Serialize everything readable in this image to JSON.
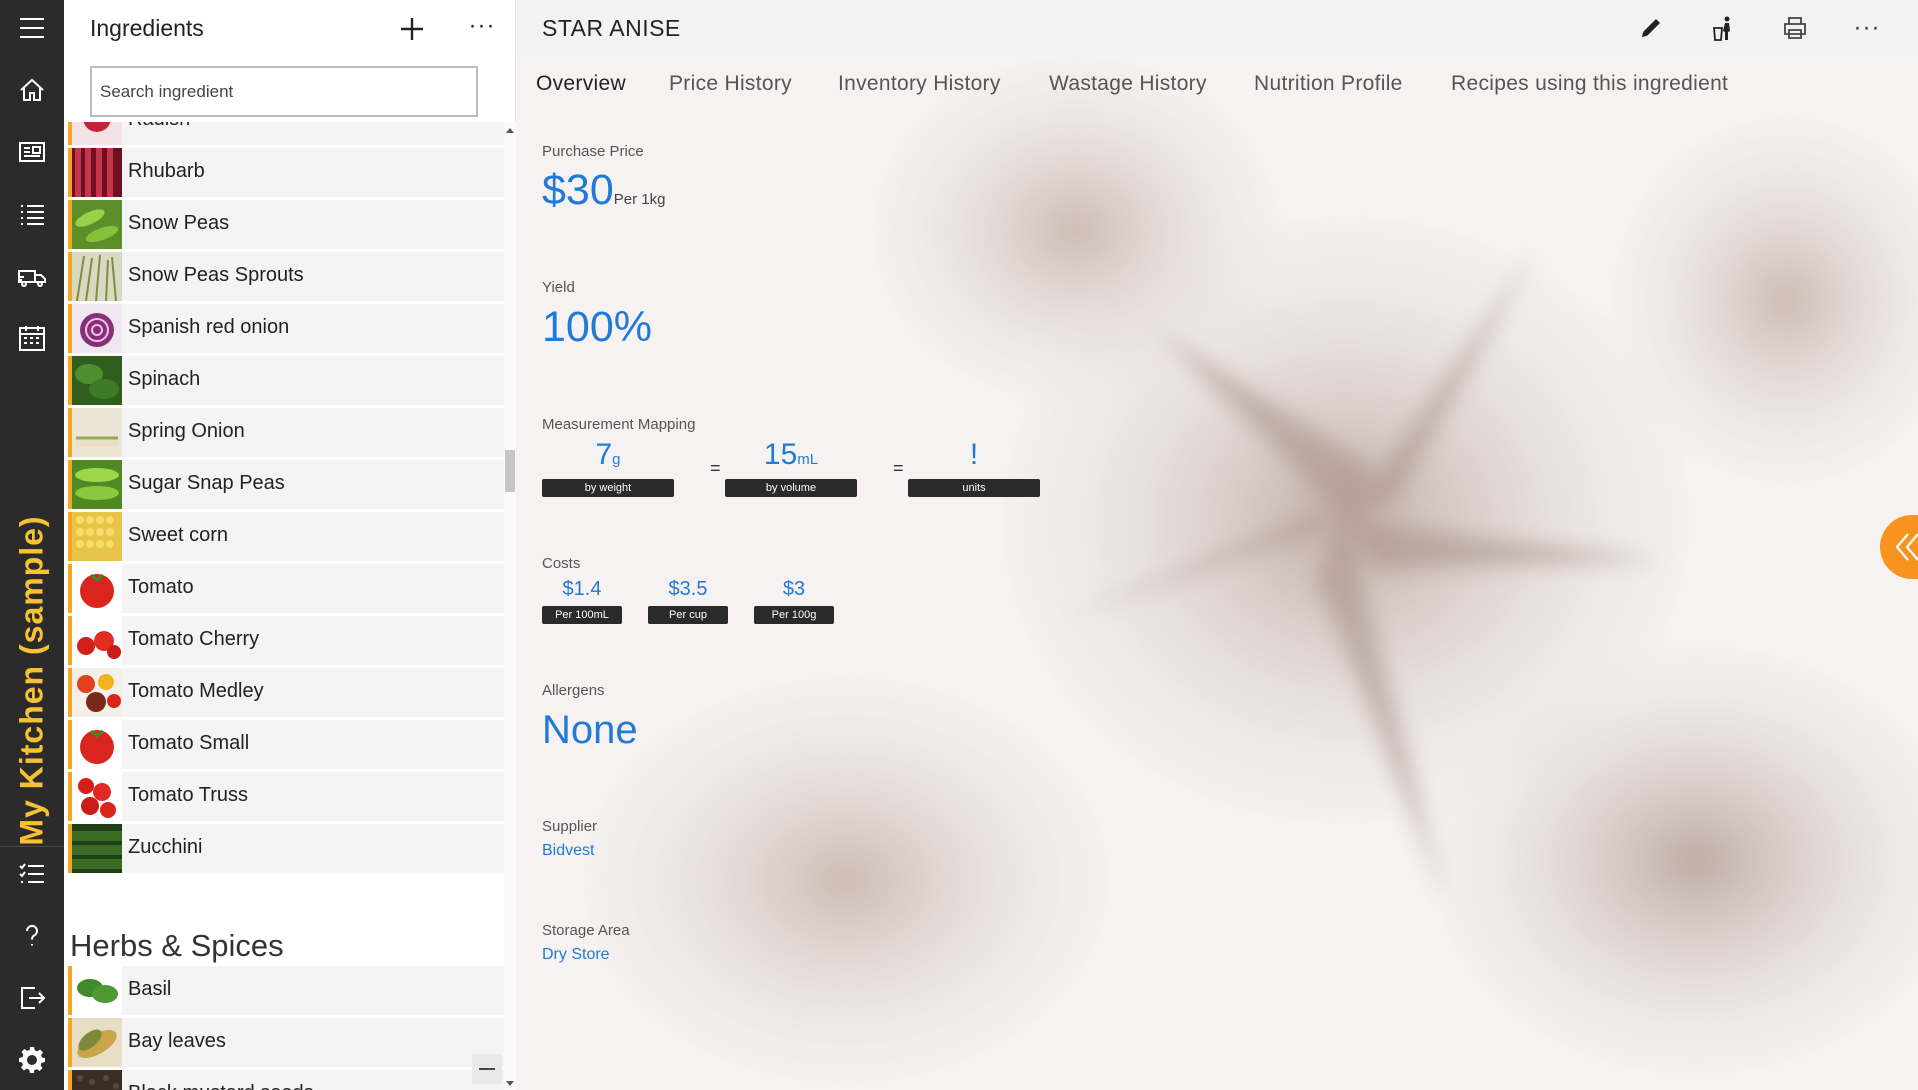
{
  "rail": {
    "title": "My Kitchen (sample)",
    "icons": [
      "menu-icon",
      "home-icon",
      "recipes-icon",
      "list-icon",
      "delivery-truck-icon",
      "calendar-icon",
      "checklist-icon",
      "help-icon",
      "logout-icon",
      "settings-icon"
    ]
  },
  "list_pane": {
    "title": "Ingredients",
    "add_icon": "plus-icon",
    "more_label": "···",
    "search_placeholder": "Search ingredient",
    "partial_top_label": "Radish",
    "vegetables": [
      {
        "label": "Rhubarb",
        "thumb": "rhubarb"
      },
      {
        "label": "Snow Peas",
        "thumb": "snowpeas"
      },
      {
        "label": "Snow Peas Sprouts",
        "thumb": "sprouts"
      },
      {
        "label": "Spanish red onion",
        "thumb": "onion"
      },
      {
        "label": "Spinach",
        "thumb": "spinach"
      },
      {
        "label": "Spring Onion",
        "thumb": "springonion"
      },
      {
        "label": "Sugar Snap Peas",
        "thumb": "snappeas"
      },
      {
        "label": "Sweet corn",
        "thumb": "corn"
      },
      {
        "label": "Tomato",
        "thumb": "tomato"
      },
      {
        "label": "Tomato Cherry",
        "thumb": "cherry"
      },
      {
        "label": "Tomato Medley",
        "thumb": "medley"
      },
      {
        "label": "Tomato Small",
        "thumb": "tomato"
      },
      {
        "label": "Tomato Truss",
        "thumb": "truss"
      },
      {
        "label": "Zucchini",
        "thumb": "zucchini"
      }
    ],
    "section_heading": "Herbs & Spices",
    "herbs": [
      {
        "label": "Basil",
        "thumb": "basil"
      },
      {
        "label": "Bay leaves",
        "thumb": "bay"
      },
      {
        "label": "Black mustard seeds",
        "thumb": "mustard"
      }
    ]
  },
  "main": {
    "title": "STAR ANISE",
    "toolbar_icons": [
      "pencil-icon",
      "trash-person-icon",
      "print-icon"
    ],
    "more_label": "···",
    "tabs": [
      "Overview",
      "Price History",
      "Inventory History",
      "Wastage History",
      "Nutrition Profile",
      "Recipes using this ingredient"
    ],
    "active_tab": "Overview",
    "purchase_price": {
      "label": "Purchase Price",
      "value": "$30",
      "unit": "Per 1kg"
    },
    "yield": {
      "label": "Yield",
      "value": "100%"
    },
    "measurement_mapping": {
      "label": "Measurement Mapping",
      "weight": {
        "value": "7",
        "unit": "g",
        "tag": "by weight"
      },
      "volume": {
        "value": "15",
        "unit": "mL",
        "tag": "by volume"
      },
      "units": {
        "value": "!",
        "unit": "",
        "tag": "units"
      },
      "eq": "="
    },
    "costs": {
      "label": "Costs",
      "items": [
        {
          "value": "$1.4",
          "tag": "Per 100mL"
        },
        {
          "value": "$3.5",
          "tag": "Per cup"
        },
        {
          "value": "$3",
          "tag": "Per 100g"
        }
      ]
    },
    "allergens": {
      "label": "Allergens",
      "value": "None"
    },
    "supplier": {
      "label": "Supplier",
      "value": "Bidvest"
    },
    "storage_area": {
      "label": "Storage Area",
      "value": "Dry Store"
    }
  },
  "colors": {
    "accent_blue": "#1f7ad8",
    "rail_bg": "#2b2b2b",
    "rail_title": "#f6c231",
    "item_border": "#f5a623",
    "side_toggle": "#f7931e"
  }
}
